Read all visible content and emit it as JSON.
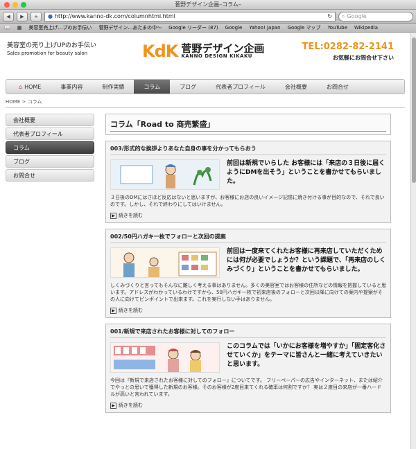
{
  "browser": {
    "window_title": "菅野デザイン企画–コラム–",
    "url": "http://www.kanno-dk.com/columnhtml.html",
    "search_placeholder": "Google",
    "bookmarks": [
      "美容室売上げ…プのお手伝い",
      "菅野デザイン…あたまの中〜",
      "Google リーダー (87)",
      "Google",
      "Yahoo! Japan",
      "Google マップ",
      "YouTube",
      "Wikipedia"
    ]
  },
  "header": {
    "tagline": "美容室の売り上げUPのお手伝い",
    "tagline_en": "Sales promotion for beauty salon",
    "logo_mark": "KdK",
    "logo_name": "菅野デザイン企画",
    "logo_sub": "KANNO DESIGN KIKAKU",
    "phone": "TEL:0282-82-2141",
    "contact_text": "お気軽にお問合せ下さい"
  },
  "nav": [
    "HOME",
    "事業内容",
    "制作実績",
    "コラム",
    "ブログ",
    "代表者プロフィール",
    "会社概要",
    "お問合せ"
  ],
  "nav_active": 3,
  "breadcrumb": {
    "home": "HOME",
    "current": "コラム",
    "sep": ">"
  },
  "sidebar": [
    "会社概要",
    "代表者プロフィール",
    "コラム",
    "ブログ",
    "お問合せ"
  ],
  "sidebar_active": 2,
  "column_title": "コラム「Road to 商売繁盛」",
  "articles": [
    {
      "title": "003/形式的な挨拶よりあなた自身の事を分かってもらおう",
      "lead": "前回は新規でいらした お客様には「来店の３日後に届くようにDMを出そう」ということを書かせてもらいました。",
      "body": "３日後のDMにはさほど反応はないと思いますが、お客様にお店の良いイメージ記憶に焼き付ける事が目的なので、それで良いのです。しかし、それで終わりにしてはいけません。",
      "more": "続きを読む"
    },
    {
      "title": "002/50円ハガキ一枚でフォローと次回の提案",
      "lead": "前回は一度来てくれたお客様に再来店していただくためには何が必要でしょうか？という課題で、「再来店のしくみづくり」ということを書かせてもらいました。",
      "body": "しくみづくりと言ってもそんなに難しく考える事はありません。多くの美容室ではお客様の住所などの情報を把握していると思います。アドレスがわかっているわけですから、50円ハガキ一枚で初来店後のフォローと次回以降に向けての案内や提案がその人に向けてピンポイントで出来ます。これを実行しない手はありません。",
      "more": "続きを読む"
    },
    {
      "title": "001/新規で来店されたお客様に対してのフォロー",
      "lead": "このコラムでは「いかにお客様を増やすか」「固定客化させていくか」をテーマに皆さんと一緒に考えていきたいと思います。",
      "body": "今回は『新規で来店されたお客様に対してのフォロー』についてです。 フリーペーパーの広告やインターネット、または紹介でやっとの思いで獲得した新規のお客様。そのお客様が2度目来てくれる確率は何割ですか？ 実は２度目の来店が一番ハードルが高いと言われています。",
      "more": "続きを読む"
    }
  ],
  "colors": {
    "accent": "#f0931a",
    "nav_active": "#4a4a4a"
  }
}
